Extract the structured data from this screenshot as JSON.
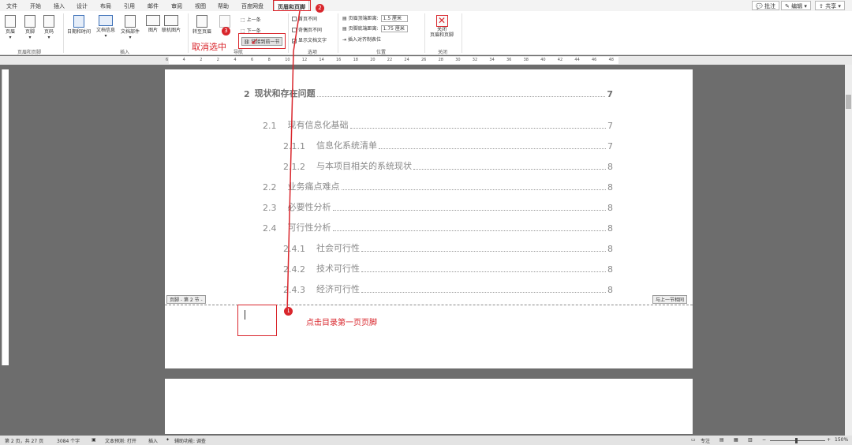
{
  "tabs": [
    "文件",
    "开始",
    "插入",
    "设计",
    "布局",
    "引用",
    "邮件",
    "审阅",
    "视图",
    "帮助",
    "百度网盘",
    "页眉和页脚"
  ],
  "top_right": {
    "comment": "批注",
    "edit": "编辑",
    "share": "共享"
  },
  "ribbon": {
    "header": "页眉",
    "footer": "页脚",
    "page_number": "页码",
    "group_header_footer": "页眉和页脚",
    "date_time": "日期和时间",
    "doc_info": "文档信息",
    "doc_parts": "文档部件",
    "picture": "图片",
    "online_picture": "联机图片",
    "group_insert": "插入",
    "goto_header": "转至页眉",
    "goto_footer_short": "转",
    "prev": "上一条",
    "next": "下一条",
    "link_prev": "链接到前一节",
    "group_nav": "导航",
    "diff_first": "首页不同",
    "diff_odd_even": "奇偶页不同",
    "show_doc_text": "显示文档文字",
    "group_options": "选项",
    "header_top": "页眉顶端距离:",
    "header_top_val": "1.5 厘米",
    "footer_bottom": "页脚底端距离:",
    "footer_bottom_val": "1.75 厘米",
    "insert_align_tab": "插入对齐制表位",
    "group_position": "位置",
    "close_hf": "关闭\n页眉和页脚",
    "group_close": "关闭"
  },
  "ruler_ticks": [
    "6",
    "4",
    "2",
    "2",
    "4",
    "6",
    "8",
    "10",
    "12",
    "14",
    "16",
    "18",
    "20",
    "22",
    "24",
    "26",
    "28",
    "30",
    "32",
    "34",
    "36",
    "38",
    "40",
    "42",
    "44",
    "46",
    "48"
  ],
  "toc": [
    {
      "num": "2",
      "title": "现状和存在问题",
      "page": "7",
      "level": 1
    },
    {
      "num": "2.1",
      "title": "现有信息化基础",
      "page": "7",
      "level": 2
    },
    {
      "num": "2.1.1",
      "title": "信息化系统清单",
      "page": "7",
      "level": 3
    },
    {
      "num": "2.1.2",
      "title": "与本项目相关的系统现状",
      "page": "8",
      "level": 3
    },
    {
      "num": "2.2",
      "title": "业务痛点难点",
      "page": "8",
      "level": 2
    },
    {
      "num": "2.3",
      "title": "必要性分析",
      "page": "8",
      "level": 2
    },
    {
      "num": "2.4",
      "title": "可行性分析",
      "page": "8",
      "level": 2
    },
    {
      "num": "2.4.1",
      "title": "社会可行性",
      "page": "8",
      "level": 3
    },
    {
      "num": "2.4.2",
      "title": "技术可行性",
      "page": "8",
      "level": 3
    },
    {
      "num": "2.4.3",
      "title": "经济可行性",
      "page": "8",
      "level": 3
    }
  ],
  "footer_tag": "页脚 - 第 2 节 -",
  "same_as_prev": "与上一节相同",
  "annotations": {
    "b1": "1",
    "b2": "2",
    "b3": "3",
    "cancel": "取消选中",
    "click_footer": "点击目录第一页页脚"
  },
  "status": {
    "page": "第 2 页，共 27 页",
    "words": "3084 个字",
    "predict": "文本预测: 打开",
    "insert": "插入",
    "access": "辅助功能: 调查",
    "focus": "专注",
    "zoom": "150%"
  },
  "colors": {
    "accent_red": "#d9262c",
    "app_bg": "#6d6d6d"
  }
}
